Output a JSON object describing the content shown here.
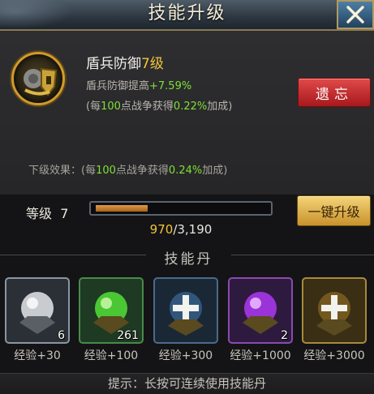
{
  "title": "技能升级",
  "skill": {
    "name": "盾兵防御",
    "level_text": "7级",
    "desc_prefix": "盾兵防御提高",
    "desc_value": "+7.59%",
    "line2_prefix": "(每",
    "line2_num": "100",
    "line2_mid": "点战争获得",
    "line2_pct": "0.22%",
    "line2_suffix": "加成)"
  },
  "next_effect": {
    "prefix": "下级效果：(每",
    "num": "100",
    "mid": "点战争获得",
    "pct": "0.24%",
    "suffix": "加成)"
  },
  "forget_label": "遗忘",
  "level": {
    "label": "等级",
    "value": "7",
    "current_exp": "970",
    "sep": "/",
    "max_exp": "3,190",
    "progress": 0.304
  },
  "onekey_label": "一键升级",
  "section_title": "技能丹",
  "pills": [
    {
      "icon": "silver-pill-icon",
      "count": "6",
      "exp": "经验+30"
    },
    {
      "icon": "green-pill-icon",
      "count": "261",
      "exp": "经验+100"
    },
    {
      "icon": "blue-pill-icon",
      "count": "",
      "exp": "经验+300"
    },
    {
      "icon": "purple-pill-icon",
      "count": "2",
      "exp": "经验+1000"
    },
    {
      "icon": "gold-pill-icon",
      "count": "",
      "exp": "经验+3000"
    }
  ],
  "hint": "提示：长按可连续使用技能丹",
  "colors": {
    "accent_gold": "#f0c43c",
    "accent_green": "#7fe034",
    "forget_red": "#c42626"
  }
}
